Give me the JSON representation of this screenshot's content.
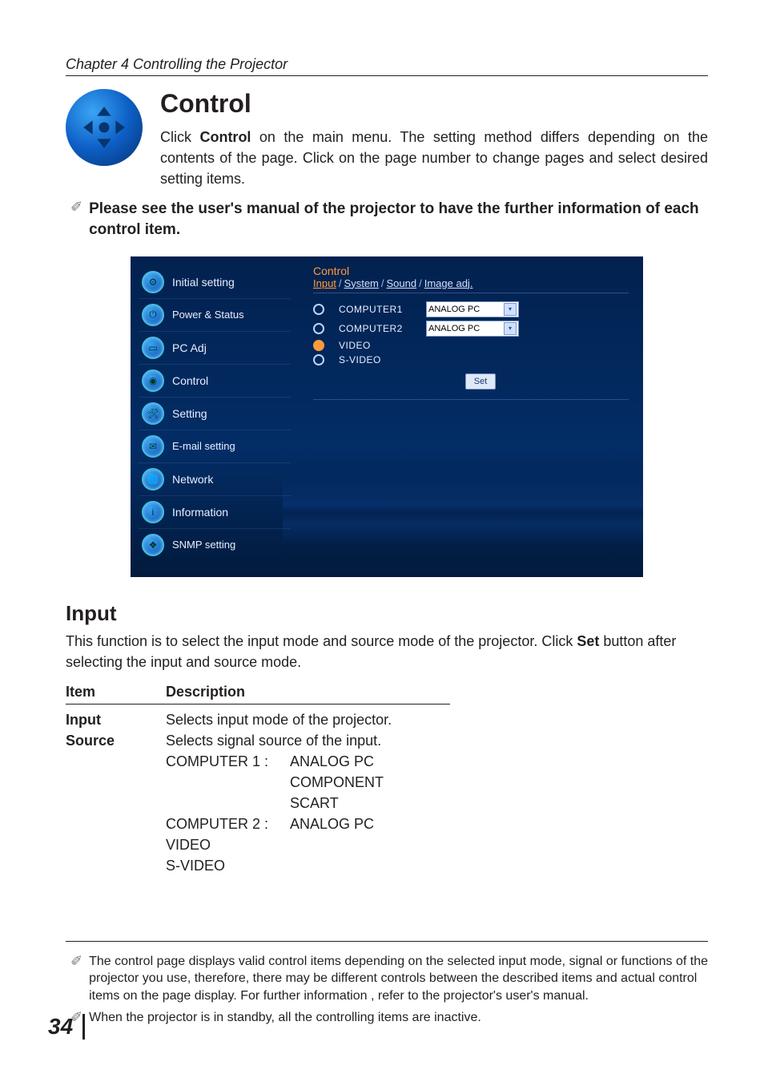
{
  "chapter_header": "Chapter 4 Controlling the Projector",
  "title": "Control",
  "intro_pre": "Click ",
  "intro_b": "Control",
  "intro_post": " on the main menu. The setting method differs depending on the contents of the page. Click on the page number to change pages and select desired setting items.",
  "top_note": "Please see the user's manual of the projector to have the further information of each control item.",
  "ui": {
    "side": [
      "Initial setting",
      "Power & Status",
      "PC Adj",
      "Control",
      "Setting",
      "E-mail setting",
      "Network",
      "Information",
      "SNMP setting"
    ],
    "main_title": "Control",
    "tabs": {
      "active": "Input",
      "rest": [
        "System",
        "Sound",
        "Image adj."
      ]
    },
    "rows": [
      {
        "label": "COMPUTER1",
        "select": "ANALOG PC",
        "selected": false,
        "has_select": true
      },
      {
        "label": "COMPUTER2",
        "select": "ANALOG PC",
        "selected": false,
        "has_select": true
      },
      {
        "label": "VIDEO",
        "selected": true,
        "has_select": false
      },
      {
        "label": "S-VIDEO",
        "selected": false,
        "has_select": false
      }
    ],
    "set_btn": "Set"
  },
  "section_title": "Input",
  "section_para_pre": "This function is to select the input mode and source mode of the projector.  Click ",
  "section_para_b": "Set",
  "section_para_post": " button after selecting the input and source mode.",
  "table": {
    "head": [
      "Item",
      "Description"
    ],
    "rows": [
      {
        "item": "Input",
        "desc": "Selects input mode of the projector."
      },
      {
        "item": "Source",
        "desc": "Selects signal source of the input."
      }
    ],
    "source_details": {
      "computer1": {
        "label": "COMPUTER 1 :",
        "values": [
          "ANALOG PC",
          "COMPONENT",
          "SCART"
        ]
      },
      "computer2": {
        "label": "COMPUTER 2 :",
        "values": [
          "ANALOG PC"
        ]
      },
      "extra": [
        "VIDEO",
        "S-VIDEO"
      ]
    }
  },
  "footnotes": [
    "The control page displays valid control items depending on the selected input mode, signal or  functions of the projector you use, therefore, there may be different controls between the described items and actual control items on the page display. For further information , refer to the projector's user's manual.",
    "When the projector is in standby, all the controlling items are inactive."
  ],
  "page_number": "34"
}
